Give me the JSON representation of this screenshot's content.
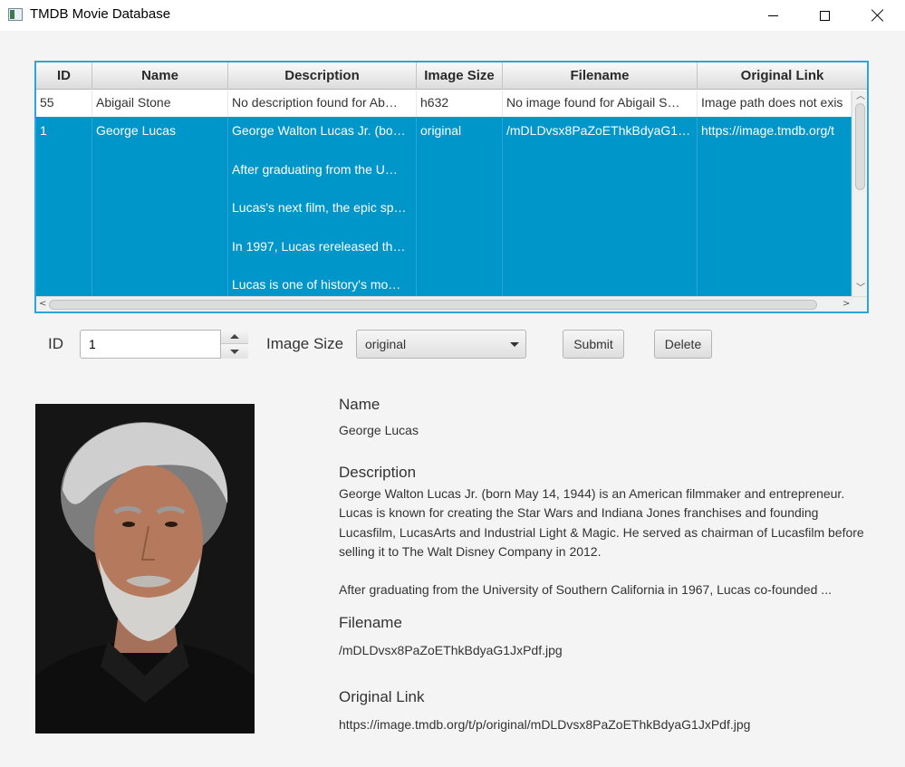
{
  "window": {
    "title": "TMDB Movie Database",
    "icons": {
      "app": "app-window-icon",
      "minimize": "minimize-icon",
      "maximize": "maximize-icon",
      "close": "close-icon"
    }
  },
  "table": {
    "columns": [
      "ID",
      "Name",
      "Description",
      "Image Size",
      "Filename",
      "Original Link"
    ],
    "rows": [
      {
        "id": "55",
        "name": "Abigail Stone",
        "description": "No description found for Ab…",
        "image_size": "h632",
        "filename": "No image found for Abigail S…",
        "original_link": "Image path does not exis"
      },
      {
        "id": "1",
        "name": "George Lucas",
        "description_lines": [
          "George Walton Lucas Jr. (bo…",
          "After graduating from the U…",
          "Lucas's next film, the epic sp…",
          "In 1997, Lucas rereleased th…",
          "Lucas is one of history's mo…"
        ],
        "image_size": "original",
        "filename": "/mDLDvsx8PaZoEThkBdyaG1…",
        "original_link": "https://image.tmdb.org/t",
        "selected": true
      }
    ],
    "selection_color": "#0096c9",
    "accent_border": "#2fa4d8"
  },
  "controls": {
    "id_label": "ID",
    "id_value": "1",
    "image_size_label": "Image Size",
    "image_size_value": "original",
    "submit_label": "Submit",
    "delete_label": "Delete"
  },
  "details": {
    "name_heading": "Name",
    "name_value": "George Lucas",
    "description_heading": "Description",
    "description_p1": "George Walton Lucas Jr. (born May 14, 1944) is an American filmmaker and entrepreneur. Lucas is known for creating the Star Wars and Indiana Jones franchises and founding Lucasfilm, LucasArts and Industrial Light & Magic. He served as chairman of Lucasfilm before selling it to The Walt Disney Company in 2012.",
    "description_p2": "After graduating from the University of Southern California in 1967, Lucas co-founded ...",
    "filename_heading": "Filename",
    "filename_value": "/mDLDvsx8PaZoEThkBdyaG1JxPdf.jpg",
    "link_heading": "Original Link",
    "link_value": "https://image.tmdb.org/t/p/original/mDLDvsx8PaZoEThkBdyaG1JxPdf.jpg"
  }
}
